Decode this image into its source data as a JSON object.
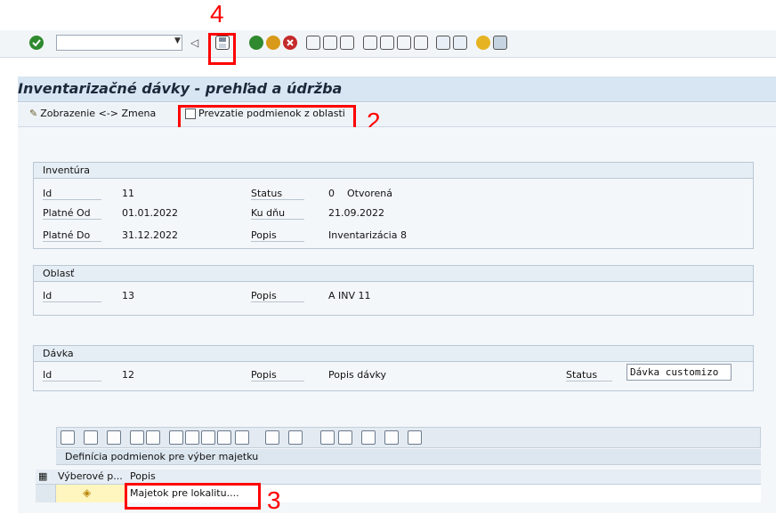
{
  "annotations": {
    "n4": "4",
    "n2": "2",
    "n3": "3"
  },
  "toolbar": {
    "command_value": ""
  },
  "title": "Inventarizačné dávky - prehľad a údržba",
  "app_toolbar": {
    "toggle_label": "Zobrazenie <-> Zmena",
    "take_label": "Prevzatie podmienok z oblasti"
  },
  "inventura": {
    "header": "Inventúra",
    "id_label": "Id",
    "id_value": "11",
    "status_label": "Status",
    "status_code": "0",
    "status_value": "Otvorená",
    "od_label": "Platné Od",
    "od_value": "01.01.2022",
    "ku_label": "Ku dňu",
    "ku_value": "21.09.2022",
    "do_label": "Platné Do",
    "do_value": "31.12.2022",
    "popis_label": "Popis",
    "popis_value": "Inventarizácia 8"
  },
  "oblast": {
    "header": "Oblasť",
    "id_label": "Id",
    "id_value": "13",
    "popis_label": "Popis",
    "popis_value": "A INV 11"
  },
  "davka": {
    "header": "Dávka",
    "id_label": "Id",
    "id_value": "12",
    "popis_label": "Popis",
    "popis_value": "Popis dávky",
    "status_label": "Status",
    "status_value": "Dávka customizo"
  },
  "grid": {
    "title": "Definícia podmienok pre výber majetku",
    "col1": "Výberové p...",
    "col2": "Popis",
    "row1_popis": "Majetok pre lokalitu...."
  }
}
